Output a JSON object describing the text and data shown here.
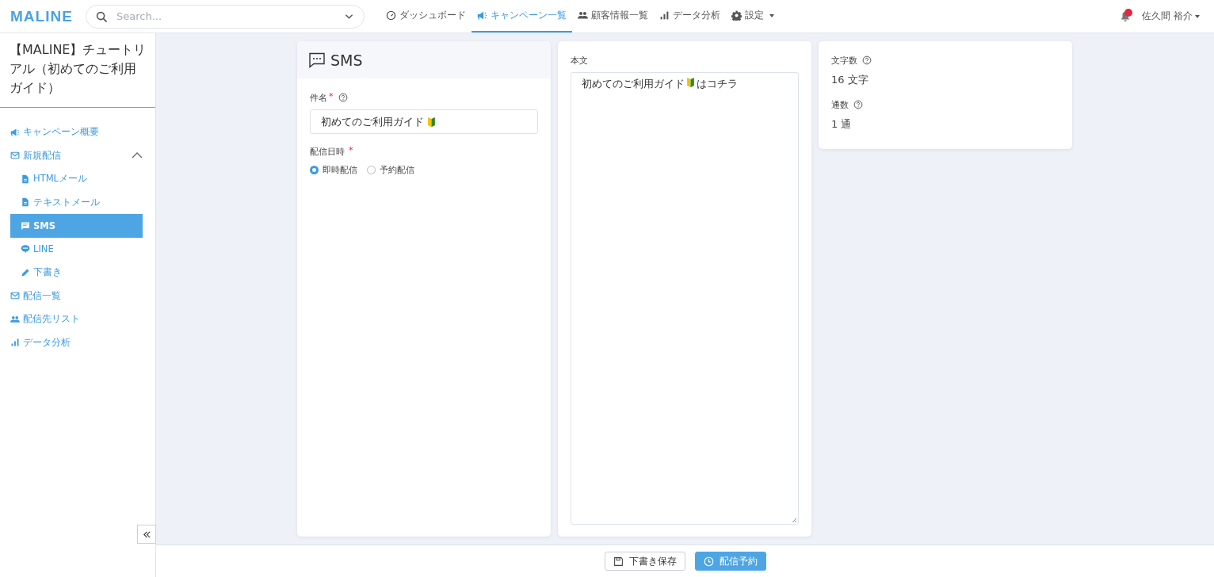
{
  "header": {
    "logo": "MALINE",
    "search": {
      "placeholder": "Search..."
    },
    "nav": [
      {
        "label": "ダッシュボード",
        "kind": "gauge",
        "selected": false,
        "dropdown": false
      },
      {
        "label": "キャンペーン一覧",
        "kind": "megaphone",
        "selected": true,
        "dropdown": false
      },
      {
        "label": "顧客情報一覧",
        "kind": "people",
        "selected": false,
        "dropdown": false
      },
      {
        "label": "データ分析",
        "kind": "bars",
        "selected": false,
        "dropdown": false
      },
      {
        "label": "設定",
        "kind": "gear",
        "selected": false,
        "dropdown": true
      }
    ],
    "notification": {
      "unread": true
    },
    "user": "佐久間 裕介"
  },
  "sidebar": {
    "title": "【MALINE】チュートリアル（初めてのご利用ガイド）",
    "items": [
      {
        "label": "キャンペーン概要",
        "kind": "megaphone",
        "selected": false
      },
      {
        "label": "新規配信",
        "kind": "mail",
        "selected": false,
        "expanded": true,
        "children": [
          {
            "label": "HTMLメール",
            "kind": "doc",
            "selected": false
          },
          {
            "label": "テキストメール",
            "kind": "doc",
            "selected": false
          },
          {
            "label": "SMS",
            "kind": "chat",
            "selected": true
          },
          {
            "label": "LINE",
            "kind": "bubble",
            "selected": false
          },
          {
            "label": "下書き",
            "kind": "pencil",
            "selected": false
          }
        ]
      },
      {
        "label": "配信一覧",
        "kind": "mail",
        "selected": false
      },
      {
        "label": "配信先リスト",
        "kind": "people",
        "selected": false
      },
      {
        "label": "データ分析",
        "kind": "bars",
        "selected": false
      }
    ]
  },
  "form": {
    "title": "SMS",
    "subject": {
      "label": "件名",
      "required_mark": "*",
      "value": "初めてのご利用ガイド"
    },
    "schedule": {
      "label": "配信日時",
      "required_mark": "*",
      "options": [
        {
          "label": "即時配信",
          "selected": true
        },
        {
          "label": "予約配信",
          "selected": false
        }
      ]
    }
  },
  "body": {
    "label": "本文",
    "text_before": "初めてのご利用ガイド",
    "text_after": "はコチラ"
  },
  "stats": [
    {
      "label": "文字数",
      "value": "16 文字"
    },
    {
      "label": "通数",
      "value": "1 通"
    }
  ],
  "footer": {
    "buttons": [
      {
        "label": "下書き保存",
        "kind": "secondary"
      },
      {
        "label": "配信予約",
        "kind": "primary"
      }
    ]
  }
}
